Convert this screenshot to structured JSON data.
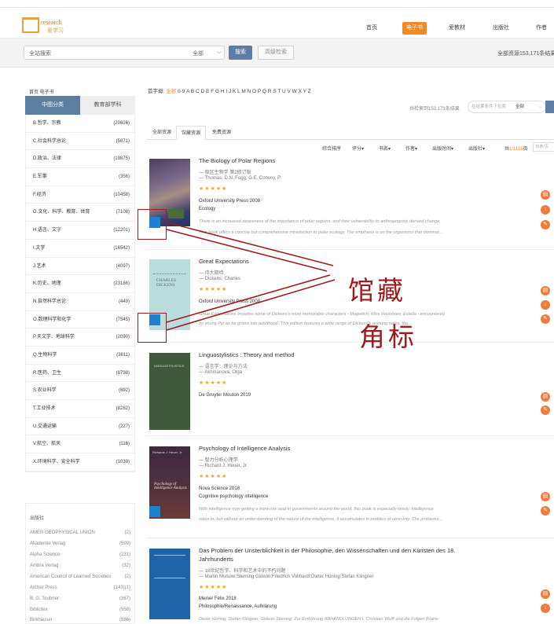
{
  "header": {
    "logo_line1": "research",
    "logo_line2": "爱学习",
    "nav": [
      {
        "label": "首页",
        "active": false
      },
      {
        "label": "电子书",
        "active": true
      },
      {
        "label": "爱教材",
        "active": false
      },
      {
        "label": "出版社",
        "active": false
      },
      {
        "label": "作者",
        "active": false
      }
    ]
  },
  "search": {
    "placeholder": "全站搜索",
    "scope": "全部",
    "button": "搜索",
    "advanced": "高级检索",
    "total": "全部资源153,171条结果"
  },
  "sidebar": {
    "breadcrumb": "首页 电子书",
    "tabs": [
      "中图分类",
      "教育部学科"
    ],
    "categories": [
      {
        "name": "B.哲学、宗教",
        "count": "(20626)"
      },
      {
        "name": "C.社会科学总论",
        "count": "(5871)"
      },
      {
        "name": "D.政治、法律",
        "count": "(19875)"
      },
      {
        "name": "E.军事",
        "count": "(356)"
      },
      {
        "name": "F.经济",
        "count": "(10458)"
      },
      {
        "name": "G.文化、科学、教育、体育",
        "count": "(7108)"
      },
      {
        "name": "H.语言、文字",
        "count": "(12201)"
      },
      {
        "name": "I.文学",
        "count": "(16542)"
      },
      {
        "name": "J.艺术",
        "count": "(4097)"
      },
      {
        "name": "K.历史、地理",
        "count": "(23186)"
      },
      {
        "name": "N.自然科学总论",
        "count": "(449)"
      },
      {
        "name": "O.数理科学和化学",
        "count": "(7545)"
      },
      {
        "name": "P.天文学、地球科学",
        "count": "(2090)"
      },
      {
        "name": "Q.生物科学",
        "count": "(3611)"
      },
      {
        "name": "R.医药、卫生",
        "count": "(8798)"
      },
      {
        "name": "S.农业科学",
        "count": "(692)"
      },
      {
        "name": "T.工业技术",
        "count": "(8282)"
      },
      {
        "name": "U.交通运输",
        "count": "(227)"
      },
      {
        "name": "V.航空、航天",
        "count": "(116)"
      },
      {
        "name": "X.环境科学、安全科学",
        "count": "(1039)"
      }
    ],
    "publisher_title": "出版社",
    "publishers": [
      {
        "name": "AMER GEOPHYSICAL UNION",
        "count": "(2)"
      },
      {
        "name": "Akademie Verlag",
        "count": "(599)"
      },
      {
        "name": "Alpha Science",
        "count": "(231)"
      },
      {
        "name": "Ambra Verlag",
        "count": "(32)"
      },
      {
        "name": "American Council of Learned Societies",
        "count": "(2)"
      },
      {
        "name": "Archer Press",
        "count": "(143)(1)"
      },
      {
        "name": "B. G. Teubner",
        "count": "(367)"
      },
      {
        "name": "Bibliotex",
        "count": "(558)"
      },
      {
        "name": "Birkhäuser",
        "count": "(886)"
      }
    ]
  },
  "main": {
    "alpha_label": "首字母:",
    "alpha_all": "全部",
    "alpha_letters": "0-9 A B C D E F G H I J K L M N O P Q R S T U V W X Y Z",
    "holding_label": "共检索到153,171条结果",
    "holding_placeholder": "在结果条件下检索",
    "holding_scope": "全部",
    "tabs": [
      "全部资源",
      "馆藏资源",
      "免费资源"
    ],
    "sort": [
      "综合排序",
      "评分",
      "书名",
      "作者",
      "出版时间",
      "出版社"
    ],
    "page_info_prefix": "共",
    "page_info": "1/1115",
    "page_info_suffix": "页",
    "page_input": "10条/页",
    "books": [
      {
        "title": "The Biology of Polar Regions",
        "subtitle": "— 极区生物学 第2修订版",
        "authors": "— Thomas, D.N.;Fogg, G.E.;Convey, P.",
        "stars": "★★★★★",
        "publisher": "Oxford University Press 2008",
        "subject": "Ecology",
        "desc1": "There is an increased awareness of the importance of polar regions, and their vulnerability to anthropogenic derived change.",
        "desc2": "This book offers a concise but comprehensive introduction to polar ecology. The emphasis is on the organisms that dominat..."
      },
      {
        "title": "Great Expectations",
        "subtitle": "— 伟大期待",
        "authors": "— Dickens, Charles",
        "stars": "★★★★★",
        "publisher": "Oxford University Press 2008",
        "subject": "",
        "desc1": "Great Expectations includes some of Dickens's most memorable characters - Magwitch, Miss Havisham, Estella - encountered",
        "desc2": "by young Pip as he grows into adulthood. This edition features a wide range of Dickens's working notes, the..."
      },
      {
        "title": "Linguostylistics : Theory and method",
        "subtitle": "— 语言学：理论与方法",
        "authors": "— Akhmanova, Olga",
        "stars": "★★★★★",
        "publisher": "De Gruyter Mouton 2019",
        "subject": "",
        "desc1": "",
        "desc2": ""
      },
      {
        "title": "Psychology of Intelligence Analysis",
        "subtitle": "— 智力分析心理学",
        "authors": "— Richard J. Heuer, Jr.",
        "stars": "★★★★★",
        "publisher": "Nova Science 2018",
        "subject": "Cognitive psychology intelligence",
        "desc1": "With intelligence now getting a front-row seat in governments around the world, this book is especially timely. Intelligence",
        "desc2": "relies in, but without an understanding of the nature of the intelligence, it accumulates in puddles of obscurity. The problems..."
      },
      {
        "title": "Das Problem der Unsterblichkeit in der Philosophie, den Wissenschaften und den Künsten des 18.",
        "title2": "Jahrhunderts",
        "subtitle": "— 18世纪哲学、科学和艺术中的不朽问题",
        "authors": "— Martin Mulsow;Sterning Gideon;Friedrich Vollhardt;Dieter Hüning;Stefan Klingner",
        "stars": "★★★★★",
        "publisher": "Meiner Felix 2018",
        "subject": "Philosophie/Renaissance, Aufklärung",
        "desc1": "Dieter Hüning, Stefan Klingner, Gideon Stiening: Zur Einführung ABHANDLUNGEN I. Christian Wolff und die Folgen (Hans-",
        "desc2": ""
      }
    ]
  },
  "annotation": {
    "line1": "馆藏",
    "line2": "角标",
    "color": "#a11b1e"
  },
  "colors": {
    "accent": "#f28a22",
    "tab_blue": "#5d7f9f",
    "search_btn": "#5c7ea6"
  }
}
